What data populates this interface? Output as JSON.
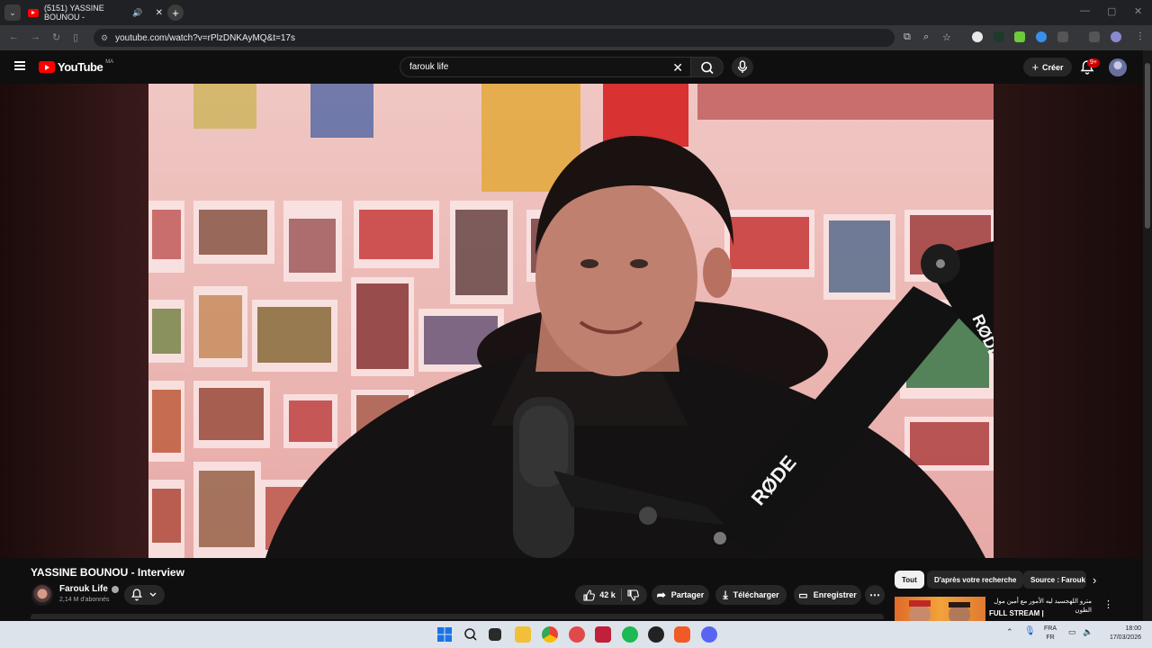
{
  "browser": {
    "tab_title": "(5151) YASSINE BOUNOU -",
    "url": "youtube.com/watch?v=rPlzDNKAyMQ&t=17s"
  },
  "youtube": {
    "logo_text": "YouTube",
    "country_code": "MA",
    "search_value": "farouk life",
    "create_label": "Créer",
    "notification_badge": "9+"
  },
  "video": {
    "title": "YASSINE BOUNOU - Interview",
    "mic_brand": "RØDE"
  },
  "channel": {
    "name": "Farouk Life",
    "subscribers": "2,14 M d'abonnés"
  },
  "actions": {
    "likes": "42 k",
    "share_label": "Partager",
    "download_label": "Télécharger",
    "save_label": "Enregistrer"
  },
  "recommendations": {
    "chips": [
      "Tout",
      "D'après votre recherche",
      "Source : Farouk"
    ],
    "first_title": "مترو اللهجسيد ليه الأمور مع أمين مول الطون",
    "first_subtitle": "FULL STREAM |"
  },
  "taskbar": {
    "lang_top": "FRA",
    "lang_bottom": "FR",
    "time": "18:00",
    "date": "17/03/2026"
  }
}
